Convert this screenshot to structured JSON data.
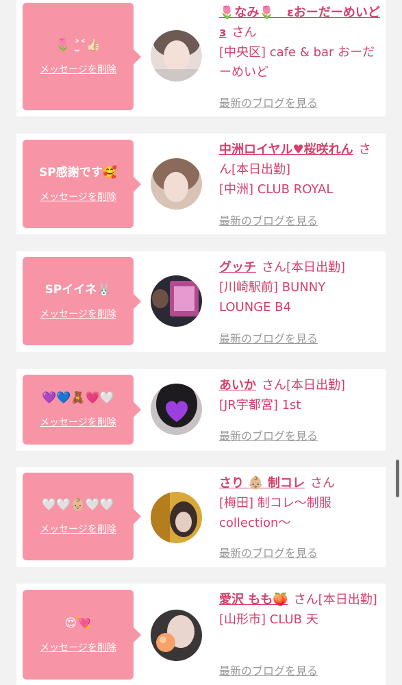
{
  "entries": [
    {
      "message": "🌷 ˃̫˂👍🏻",
      "delete_label": "メッセージを削除",
      "name": "🌷なみ🌷　εおーだーめいどз",
      "honorific": "さん",
      "area": "[中央区] cafe & bar おーだーめいど",
      "blog_label": "最新のブログを見る"
    },
    {
      "message": "SP感謝です🥰",
      "delete_label": "メッセージを削除",
      "name": "中洲ロイヤル♥桜咲れん",
      "honorific": "さん[本日出勤]",
      "area": "[中洲] CLUB ROYAL",
      "blog_label": "最新のブログを見る"
    },
    {
      "message": "SPイイネ🐰",
      "delete_label": "メッセージを削除",
      "name": "グッチ",
      "honorific": "さん[本日出勤]",
      "area": "[川崎駅前] BUNNY LOUNGE B4",
      "blog_label": "最新のブログを見る"
    },
    {
      "message": "💜💙🧸💗🤍",
      "delete_label": "メッセージを削除",
      "name": "あいか",
      "honorific": "さん[本日出勤]",
      "area": "[JR宇都宮] 1st",
      "blog_label": "最新のブログを見る"
    },
    {
      "message": "🤍🤍👶🏼🤍🤍",
      "delete_label": "メッセージを削除",
      "name": "さり 👶🏼 制コレ",
      "honorific": "さん",
      "area": "[梅田] 制コレ〜制服collection〜",
      "blog_label": "最新のブログを見る"
    },
    {
      "message": "😍💘",
      "delete_label": "メッセージを削除",
      "name": "愛沢 もも🍑",
      "honorific": "さん[本日出勤]",
      "area": "[山形市] CLUB 天",
      "blog_label": "最新のブログを見る"
    }
  ],
  "colors": {
    "bubble": "#f794a6",
    "name": "#d63f6a",
    "link": "#9a9a9a",
    "background": "#f2f2f2"
  }
}
